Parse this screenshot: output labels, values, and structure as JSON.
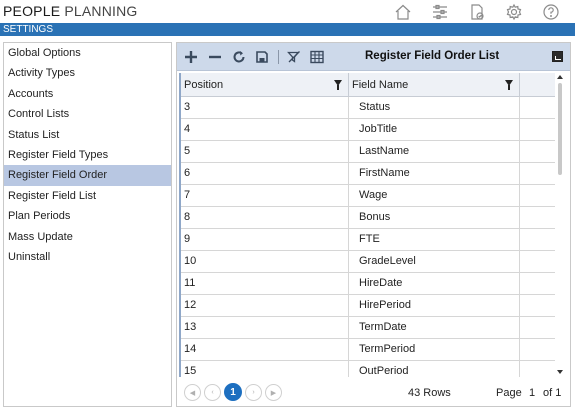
{
  "app": {
    "title_part1": "PEOPLE",
    "title_part2": "PLANNING",
    "section": "SETTINGS"
  },
  "top_icons": [
    "home-icon",
    "sliders-icon",
    "document-check-icon",
    "gear-icon",
    "help-icon"
  ],
  "sidebar": {
    "items": [
      {
        "label": "Global Options"
      },
      {
        "label": "Activity Types"
      },
      {
        "label": "Accounts"
      },
      {
        "label": "Control Lists"
      },
      {
        "label": "Status List"
      },
      {
        "label": "Register Field Types"
      },
      {
        "label": "Register Field Order",
        "active": true
      },
      {
        "label": "Register Field List"
      },
      {
        "label": "Plan Periods"
      },
      {
        "label": "Mass Update"
      },
      {
        "label": "Uninstall"
      }
    ]
  },
  "panel": {
    "title": "Register Field Order List",
    "toolbar_icons": [
      "add-icon",
      "remove-icon",
      "refresh-icon",
      "save-icon",
      "clear-filter-icon",
      "columns-icon",
      "expand-icon"
    ]
  },
  "grid": {
    "columns": [
      {
        "label": "Position"
      },
      {
        "label": "Field Name"
      }
    ],
    "rows": [
      {
        "position": "3",
        "field": "Status"
      },
      {
        "position": "4",
        "field": "JobTitle"
      },
      {
        "position": "5",
        "field": "LastName"
      },
      {
        "position": "6",
        "field": "FirstName"
      },
      {
        "position": "7",
        "field": "Wage"
      },
      {
        "position": "8",
        "field": "Bonus"
      },
      {
        "position": "9",
        "field": "FTE"
      },
      {
        "position": "10",
        "field": "GradeLevel"
      },
      {
        "position": "11",
        "field": "HireDate"
      },
      {
        "position": "12",
        "field": "HirePeriod"
      },
      {
        "position": "13",
        "field": "TermDate"
      },
      {
        "position": "14",
        "field": "TermPeriod"
      },
      {
        "position": "15",
        "field": "OutPeriod"
      }
    ]
  },
  "pager": {
    "current_page": "1",
    "rows_count": "43 Rows",
    "page_label": "Page",
    "page_num": "1",
    "of_label": "of 1"
  },
  "colors": {
    "brand_bar": "#2a72b5",
    "toolbar_bg": "#cdd9ea",
    "active_item": "#b8c7e2",
    "pager_current": "#1d6fc0"
  }
}
